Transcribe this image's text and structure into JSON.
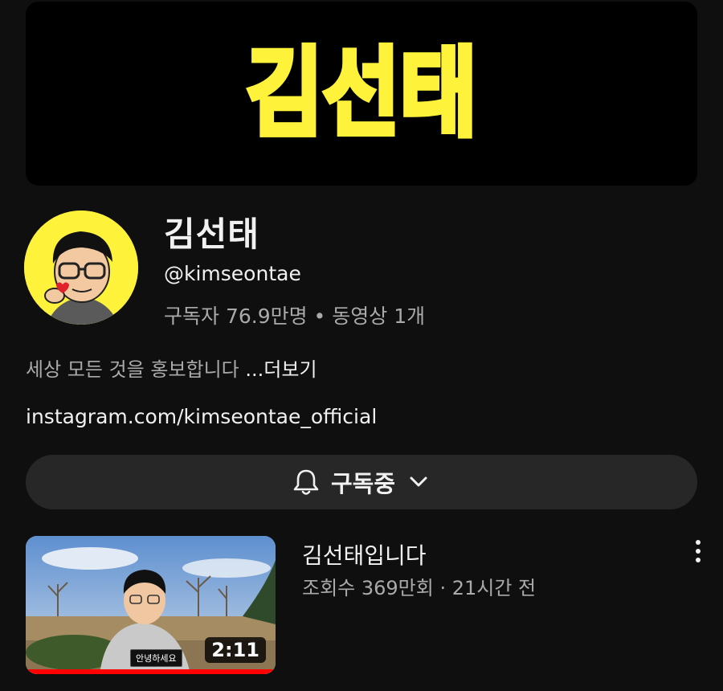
{
  "banner": {
    "logo_text": "김선태",
    "logo_color": "#fff23a"
  },
  "channel": {
    "name": "김선태",
    "handle": "@kimseontae",
    "stats": "구독자 76.9만명 • 동영상 1개",
    "description": "세상 모든 것을 홍보합니다 ",
    "more_label": "...더보기",
    "link": "instagram.com/kimseontae_official"
  },
  "subscribe": {
    "label": "구독중",
    "icons": {
      "bell": "bell-icon",
      "chevron": "chevron-down-icon"
    }
  },
  "video": {
    "title": "김선태입니다",
    "meta": "조회수 369만회 · 21시간 전",
    "duration": "2:11",
    "caption": "안녕하세요",
    "progress": 1.0,
    "menu_icon": "more-vert-icon"
  },
  "colors": {
    "background": "#0f0f0f",
    "button_bg": "#272727",
    "secondary_text": "#aaaaaa",
    "progress": "#ff0000"
  }
}
